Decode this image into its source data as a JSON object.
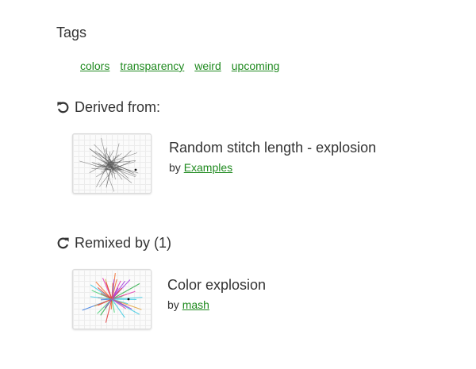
{
  "tags_section": {
    "title": "Tags",
    "tags": [
      "colors",
      "transparency",
      "weird",
      "upcoming"
    ]
  },
  "derived_section": {
    "title": "Derived from:",
    "icon": "undo-icon",
    "item": {
      "title": "Random stitch length - explosion",
      "by_prefix": "by",
      "author": "Examples"
    }
  },
  "remixed_section": {
    "title": "Remixed by (1)",
    "icon": "redo-icon",
    "item": {
      "title": "Color explosion",
      "by_prefix": "by",
      "author": "mash"
    }
  },
  "colors": {
    "link": "#1f8a1f",
    "text": "#333333"
  }
}
